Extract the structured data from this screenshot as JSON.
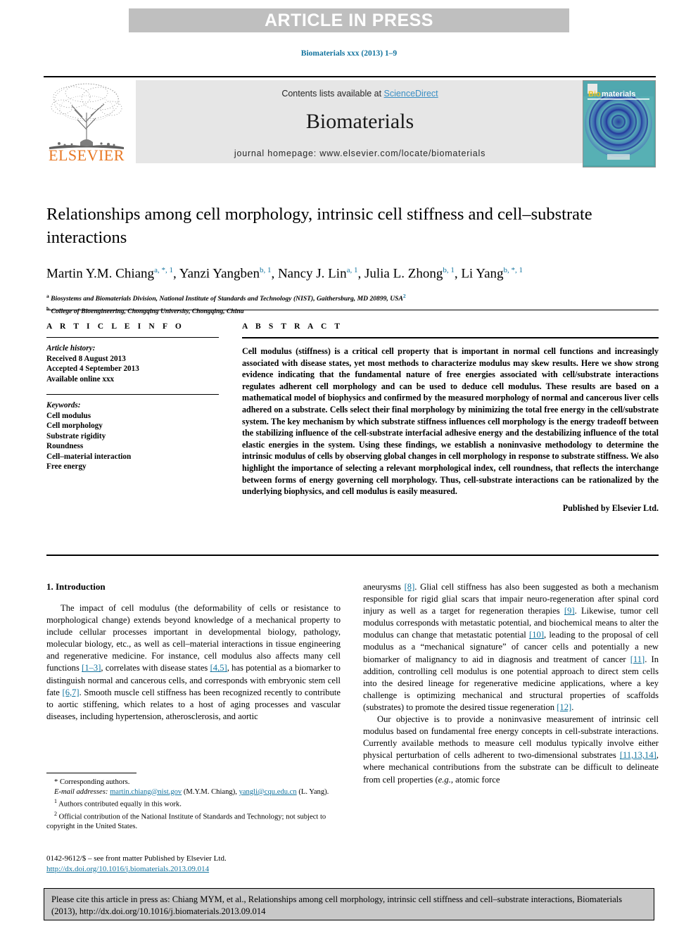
{
  "banner": {
    "text": "ARTICLE IN PRESS"
  },
  "running_head": "Biomaterials xxx (2013) 1–9",
  "masthead": {
    "contents_prefix": "Contents lists available at ",
    "sciencedirect": "ScienceDirect",
    "journal_name": "Biomaterials",
    "homepage": "journal homepage: www.elsevier.com/locate/biomaterials",
    "publisher_logo_text": "ELSEVIER",
    "cover_title_first": "Bio",
    "cover_title_rest": "materials",
    "accent_blue": "#3a8fc4",
    "link_blue": "#12739e",
    "elsevier_orange": "#e87722",
    "banner_gray": "#bfbfbf",
    "masthead_gray": "#e6e6e6"
  },
  "article": {
    "title": "Relationships among cell morphology, intrinsic cell stiffness and cell–substrate interactions",
    "authors": [
      {
        "name": "Martin Y.M. Chiang",
        "marks": "a, *, 1"
      },
      {
        "name": "Yanzi Yangben",
        "marks": "b, 1"
      },
      {
        "name": "Nancy J. Lin",
        "marks": "a, 1"
      },
      {
        "name": "Julia L. Zhong",
        "marks": "b, 1"
      },
      {
        "name": "Li Yang",
        "marks": "b, *, 1"
      }
    ],
    "affiliations": [
      {
        "mark": "a",
        "text": "Biosystems and Biomaterials Division, National Institute of Standards and Technology (NIST), Gaithersburg, MD 20899, USA",
        "trailing_mark": "2"
      },
      {
        "mark": "b",
        "text": "College of Bioengineering, Chongqing University, Chongqing, China",
        "trailing_mark": ""
      }
    ]
  },
  "article_info": {
    "kicker": "A R T I C L E    I N F O",
    "history_label": "Article history:",
    "history": [
      "Received 8 August 2013",
      "Accepted 4 September 2013",
      "Available online xxx"
    ],
    "keywords_label": "Keywords:",
    "keywords": [
      "Cell modulus",
      "Cell morphology",
      "Substrate rigidity",
      "Roundness",
      "Cell–material interaction",
      "Free energy"
    ]
  },
  "abstract": {
    "kicker": "A B S T R A C T",
    "text": "Cell modulus (stiffness) is a critical cell property that is important in normal cell functions and increasingly associated with disease states, yet most methods to characterize modulus may skew results. Here we show strong evidence indicating that the fundamental nature of free energies associated with cell/substrate interactions regulates adherent cell morphology and can be used to deduce cell modulus. These results are based on a mathematical model of biophysics and confirmed by the measured morphology of normal and cancerous liver cells adhered on a substrate. Cells select their final morphology by minimizing the total free energy in the cell/substrate system. The key mechanism by which substrate stiffness influences cell morphology is the energy tradeoff between the stabilizing influence of the cell-substrate interfacial adhesive energy and the destabilizing influence of the total elastic energies in the system. Using these findings, we establish a noninvasive methodology to determine the intrinsic modulus of cells by observing global changes in cell morphology in response to substrate stiffness. We also highlight the importance of selecting a relevant morphological index, cell roundness, that reflects the interchange between forms of energy governing cell morphology. Thus, cell-substrate interactions can be rationalized by the underlying biophysics, and cell modulus is easily measured.",
    "published_by": "Published by Elsevier Ltd."
  },
  "introduction": {
    "heading": "1.  Introduction",
    "left_paragraph_parts": [
      "The impact of cell modulus (the deformability of cells or resistance to morphological change) extends beyond knowledge of a mechanical property to include cellular processes important in developmental biology, pathology, molecular biology, etc., as well as cell–material interactions in tissue engineering and regenerative medicine. For instance, cell modulus also affects many cell functions ",
      "[1–3]",
      ", correlates with disease states ",
      "[4,5]",
      ", has potential as a biomarker to distinguish normal and cancerous cells, and corresponds with embryonic stem cell fate ",
      "[6,7]",
      ". Smooth muscle cell stiffness has been recognized recently to contribute to aortic stiffening, which relates to a host of aging processes and vascular diseases, including hypertension, atherosclerosis, and aortic"
    ],
    "right_paragraph1_parts": [
      "aneurysms ",
      "[8]",
      ". Glial cell stiffness has also been suggested as both a mechanism responsible for rigid glial scars that impair neuro-regeneration after spinal cord injury as well as a target for regeneration therapies ",
      "[9]",
      ". Likewise, tumor cell modulus corresponds with metastatic potential, and biochemical means to alter the modulus can change that metastatic potential ",
      "[10]",
      ", leading to the proposal of cell modulus as a “mechanical signature” of cancer cells and potentially a new biomarker of malignancy to aid in diagnosis and treatment of cancer ",
      "[11]",
      ". In addition, controlling cell modulus is one potential approach to direct stem cells into the desired lineage for regenerative medicine applications, where a key challenge is optimizing mechanical and structural properties of scaffolds (substrates) to promote the desired tissue regeneration ",
      "[12]",
      "."
    ],
    "right_paragraph2_parts": [
      "Our objective is to provide a noninvasive measurement of intrinsic cell modulus based on fundamental free energy concepts in cell-substrate interactions. Currently available methods to measure cell modulus typically involve either physical perturbation of cells adherent to two-dimensional substrates ",
      "[11,13,14]",
      ", where mechanical contributions from the substrate can be difficult to delineate from cell properties (",
      "e.g.",
      ", atomic force"
    ]
  },
  "footnotes": {
    "corresponding": "* Corresponding authors.",
    "email_label": "E-mail addresses:",
    "email1": "martin.chiang@nist.gov",
    "email1_owner": "(M.Y.M. Chiang),",
    "email2": "yangli@cqu.edu.cn",
    "email2_owner": "(L. Yang).",
    "note1_mark": "1",
    "note1": "Authors contributed equally in this work.",
    "note2_mark": "2",
    "note2": "Official contribution of the National Institute of Standards and Technology; not subject to copyright in the United States.",
    "issn_line": "0142-9612/$ – see front matter Published by Elsevier Ltd.",
    "doi_line": "http://dx.doi.org/10.1016/j.biomaterials.2013.09.014"
  },
  "citation_box": {
    "text": "Please cite this article in press as: Chiang MYM, et al., Relationships among cell morphology, intrinsic cell stiffness and cell–substrate interactions, Biomaterials (2013), http://dx.doi.org/10.1016/j.biomaterials.2013.09.014"
  }
}
